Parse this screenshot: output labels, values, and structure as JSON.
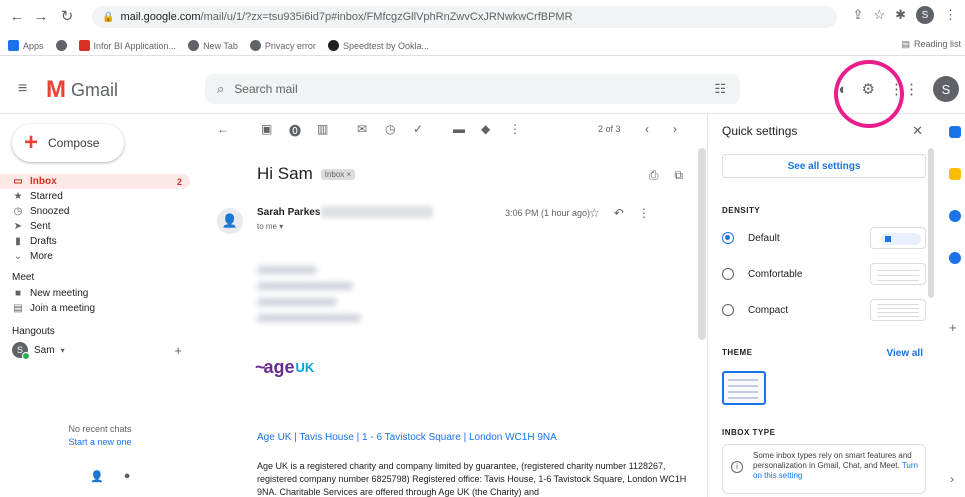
{
  "browser": {
    "url_host": "mail.google.com",
    "url_path": "/mail/u/1/?zx=tsu935i6id7p#inbox/FMfcgzGllVphRnZwvCxJRNwkwCrfBPMR",
    "bookmarks": [
      "Apps",
      "Infor BI Application...",
      "New Tab",
      "Privacy error",
      "Speedtest by Ookla..."
    ],
    "reading_list": "Reading list",
    "profile_initial": "S"
  },
  "header": {
    "product": "Gmail",
    "search_placeholder": "Search mail",
    "avatar_initial": "S"
  },
  "nav": {
    "compose": "Compose",
    "items": [
      {
        "label": "Inbox",
        "count": "2"
      },
      {
        "label": "Starred"
      },
      {
        "label": "Snoozed"
      },
      {
        "label": "Sent"
      },
      {
        "label": "Drafts"
      },
      {
        "label": "More"
      }
    ],
    "meet_title": "Meet",
    "meet_items": [
      "New meeting",
      "Join a meeting"
    ],
    "hangouts_title": "Hangouts",
    "hangouts_user": "Sam",
    "hangouts_initial": "S",
    "no_chats": "No recent chats",
    "start_new": "Start a new one"
  },
  "message": {
    "pager": "2 of 3",
    "subject": "Hi Sam",
    "label": "Inbox",
    "sender": "Sarah Parkes",
    "to": "to me",
    "time": "3:06 PM (1 hour ago)",
    "address": "Age UK | Tavis House | 1 - 6 Tavistock Square | London WC1H 9NA",
    "paragraph": "Age UK is a registered charity and company limited by guarantee, (registered charity number 1128267, registered company number 6825798) Registered office: Tavis House, 1-6 Tavistock Square, London WC1H 9NA. Charitable Services are offered through Age UK (the Charity) and"
  },
  "quick_settings": {
    "title": "Quick settings",
    "see_all": "See all settings",
    "density_label": "DENSITY",
    "density_options": [
      "Default",
      "Comfortable",
      "Compact"
    ],
    "selected_density": "Default",
    "theme_label": "THEME",
    "view_all": "View all",
    "inbox_type_label": "INBOX TYPE",
    "inbox_card_text": "Some inbox types rely on smart features and personalization in Gmail, Chat, and Meet.",
    "turn_on": "Turn on this setting"
  },
  "colors": {
    "accent": "#1a73e8",
    "inbox_active": "#d93025",
    "highlight_ring": "#e91e8c"
  }
}
